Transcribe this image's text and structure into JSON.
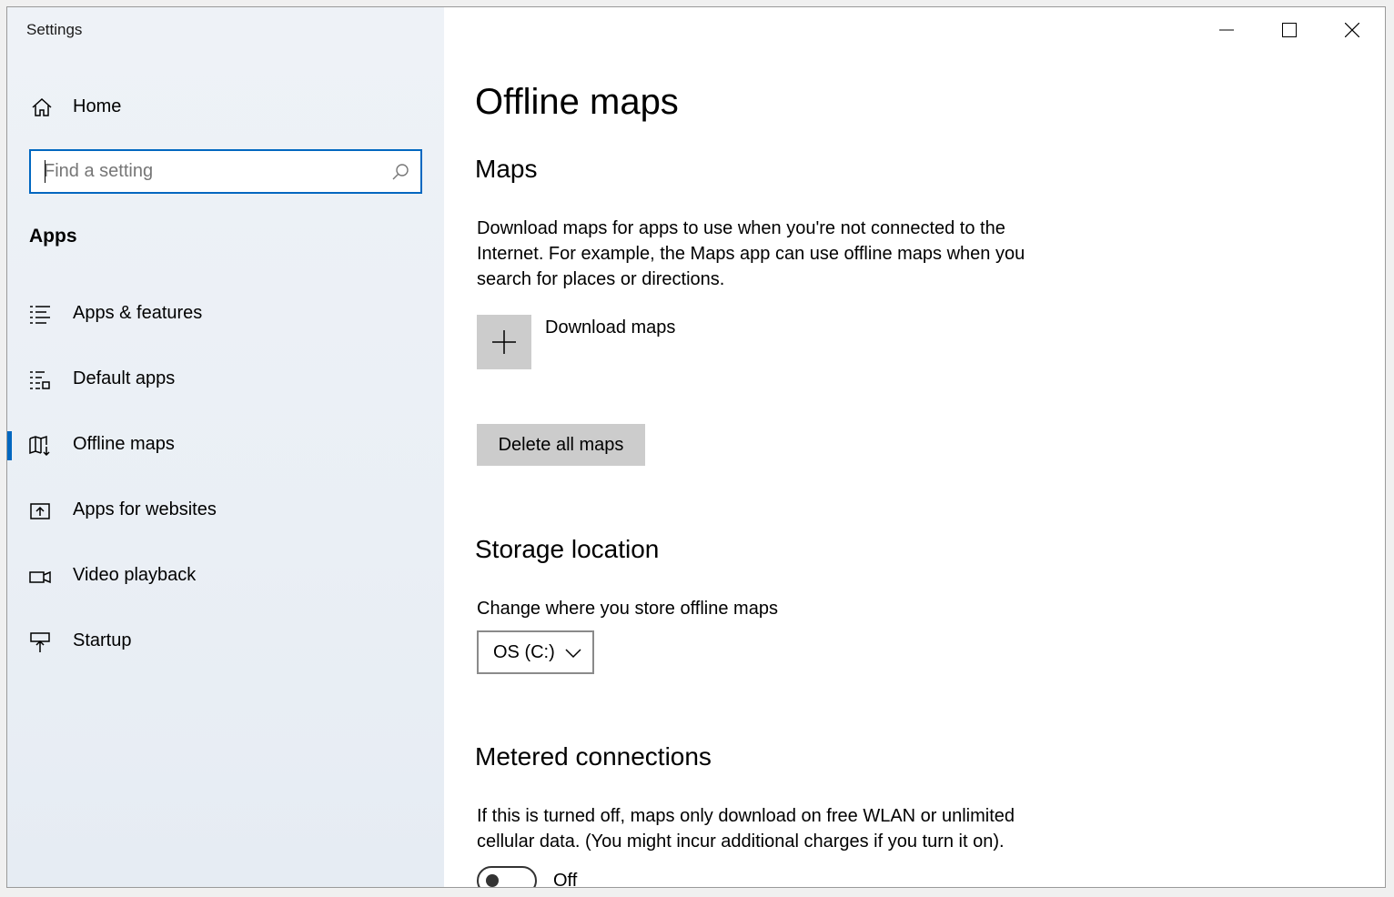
{
  "window": {
    "title": "Settings"
  },
  "sidebar": {
    "home_label": "Home",
    "search_placeholder": "Find a setting",
    "section": "Apps",
    "items": [
      {
        "label": "Apps & features",
        "icon": "list-icon",
        "selected": false
      },
      {
        "label": "Default apps",
        "icon": "default-apps-icon",
        "selected": false
      },
      {
        "label": "Offline maps",
        "icon": "map-download-icon",
        "selected": true
      },
      {
        "label": "Apps for websites",
        "icon": "open-in-app-icon",
        "selected": false
      },
      {
        "label": "Video playback",
        "icon": "video-camera-icon",
        "selected": false
      },
      {
        "label": "Startup",
        "icon": "startup-icon",
        "selected": false
      }
    ]
  },
  "main": {
    "title": "Offline maps",
    "maps": {
      "heading": "Maps",
      "description": "Download maps for apps to use when you're not connected to the Internet. For example, the Maps app can use offline maps when you search for places or directions.",
      "download_label": "Download maps",
      "delete_label": "Delete all maps"
    },
    "storage": {
      "heading": "Storage location",
      "description": "Change where you store offline maps",
      "selected_drive": "OS (C:)"
    },
    "metered": {
      "heading": "Metered connections",
      "description": "If this is turned off, maps only download on free WLAN or unlimited cellular data. (You might incur additional charges if you turn it on).",
      "toggle_state": "Off"
    }
  },
  "colors": {
    "accent": "#0067c0",
    "button_bg": "#cccccc"
  }
}
